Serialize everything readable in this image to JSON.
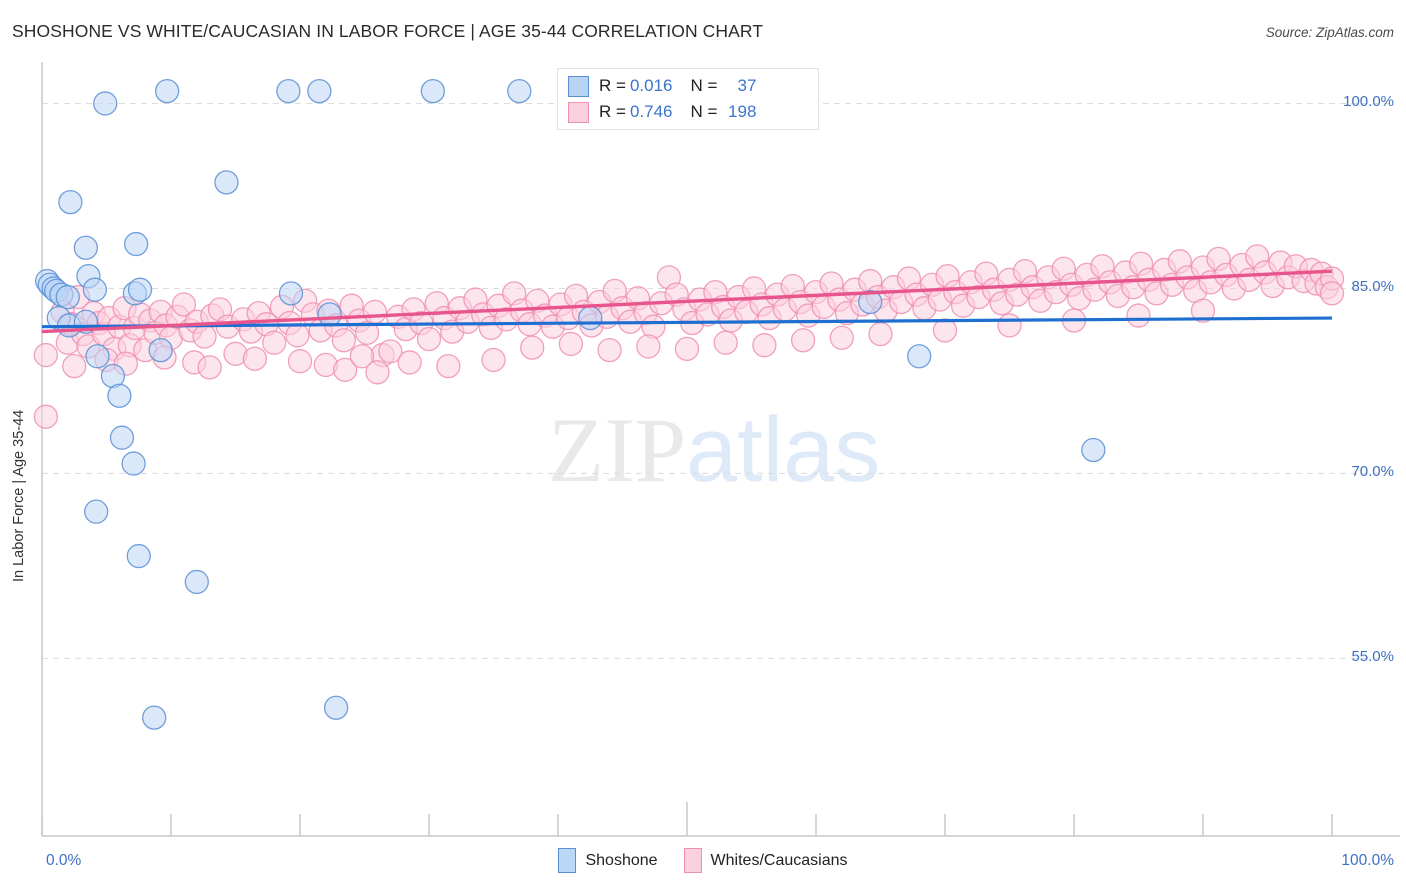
{
  "header": {
    "title": "SHOSHONE VS WHITE/CAUCASIAN IN LABOR FORCE | AGE 35-44 CORRELATION CHART",
    "source": "Source: ZipAtlas.com"
  },
  "watermark": {
    "part1": "ZIP",
    "part2": "atlas"
  },
  "axes": {
    "ylabel": "In Labor Force | Age 35-44",
    "yticks": [
      "100.0%",
      "85.0%",
      "70.0%",
      "55.0%"
    ],
    "xticks": [
      "0.0%",
      "100.0%"
    ]
  },
  "stats_legend": {
    "rows": [
      {
        "series": "Shoshone",
        "r_label": "R =",
        "r_value": "0.016",
        "n_label": "N =",
        "n_value": "37",
        "color": "#b9d3f2"
      },
      {
        "series": "Whites/Caucasians",
        "r_label": "R =",
        "r_value": "0.746",
        "n_label": "N =",
        "n_value": "198",
        "color": "#fbd0de"
      }
    ]
  },
  "series_legend": [
    {
      "label": "Shoshone",
      "color": "#bcd6f5"
    },
    {
      "label": "Whites/Caucasians",
      "color": "#fbd0de"
    }
  ],
  "colors": {
    "blue_fill": "#bcd6f5",
    "blue_stroke": "#5a8fd4",
    "pink_fill": "#fbd0de",
    "pink_stroke": "#ef8fb2",
    "blue_line": "#1f6fd0",
    "pink_line": "#e8548c",
    "tick_text": "#3f6fc4",
    "grid": "#dcdcdc"
  },
  "chart_data": {
    "type": "scatter",
    "title": "SHOSHONE VS WHITE/CAUCASIAN IN LABOR FORCE | AGE 35-44 CORRELATION CHART",
    "xlabel": "",
    "ylabel": "In Labor Force | Age 35-44",
    "xlim": [
      0,
      100
    ],
    "ylim": [
      40.6,
      103.2
    ],
    "xticks": [
      0,
      100
    ],
    "yticks": [
      100.0,
      85.0,
      70.0,
      55.0
    ],
    "grid": true,
    "legend_position": "bottom-center",
    "series": [
      {
        "name": "Shoshone",
        "color": "#bcd6f5",
        "R": 0.016,
        "N": 37,
        "trendline": {
          "x0": 0,
          "y0": 81.9,
          "x1": 100,
          "y1": 82.6
        },
        "points": [
          [
            4.9,
            100.0
          ],
          [
            9.7,
            101.0
          ],
          [
            19.1,
            101.0
          ],
          [
            21.5,
            101.0
          ],
          [
            30.3,
            101.0
          ],
          [
            37.0,
            101.0
          ],
          [
            14.3,
            93.6
          ],
          [
            2.2,
            92.0
          ],
          [
            3.4,
            88.3
          ],
          [
            7.3,
            88.6
          ],
          [
            0.4,
            85.6
          ],
          [
            0.6,
            85.3
          ],
          [
            0.9,
            85.0
          ],
          [
            1.1,
            84.8
          ],
          [
            1.5,
            84.5
          ],
          [
            2.0,
            84.3
          ],
          [
            3.6,
            86.0
          ],
          [
            4.1,
            84.9
          ],
          [
            7.2,
            84.6
          ],
          [
            7.6,
            84.9
          ],
          [
            19.3,
            84.6
          ],
          [
            1.3,
            82.6
          ],
          [
            2.1,
            82.0
          ],
          [
            3.4,
            82.3
          ],
          [
            22.3,
            82.9
          ],
          [
            42.5,
            82.6
          ],
          [
            64.2,
            83.9
          ],
          [
            4.3,
            79.5
          ],
          [
            9.2,
            80.0
          ],
          [
            68.0,
            79.5
          ],
          [
            5.5,
            77.9
          ],
          [
            6.0,
            76.3
          ],
          [
            6.2,
            72.9
          ],
          [
            7.1,
            70.8
          ],
          [
            4.2,
            66.9
          ],
          [
            7.5,
            63.3
          ],
          [
            12.0,
            61.2
          ],
          [
            81.5,
            71.9
          ],
          [
            8.7,
            50.2
          ],
          [
            22.8,
            51.0
          ]
        ]
      },
      {
        "name": "Whites/Caucasians",
        "color": "#fbd0de",
        "R": 0.746,
        "N": 198,
        "trendline": {
          "x0": 0,
          "y0": 81.5,
          "x1": 100,
          "y1": 86.4
        },
        "points": [
          [
            0.3,
            79.6
          ],
          [
            0.3,
            74.6
          ],
          [
            1.6,
            83.1
          ],
          [
            2.0,
            80.6
          ],
          [
            2.3,
            82.1
          ],
          [
            2.8,
            84.3
          ],
          [
            3.2,
            81.3
          ],
          [
            3.6,
            80.3
          ],
          [
            4.0,
            83.0
          ],
          [
            4.4,
            82.2
          ],
          [
            4.8,
            81.3
          ],
          [
            5.2,
            82.6
          ],
          [
            5.6,
            80.1
          ],
          [
            6.0,
            81.9
          ],
          [
            6.4,
            83.4
          ],
          [
            6.8,
            80.4
          ],
          [
            7.2,
            81.8
          ],
          [
            7.6,
            82.9
          ],
          [
            8.0,
            80.0
          ],
          [
            8.4,
            82.4
          ],
          [
            8.8,
            81.4
          ],
          [
            9.2,
            83.1
          ],
          [
            9.6,
            82.0
          ],
          [
            10.0,
            81.0
          ],
          [
            10.5,
            82.7
          ],
          [
            11.0,
            83.7
          ],
          [
            11.5,
            81.6
          ],
          [
            12.0,
            82.3
          ],
          [
            12.6,
            81.1
          ],
          [
            13.2,
            82.8
          ],
          [
            13.8,
            83.3
          ],
          [
            14.4,
            81.9
          ],
          [
            15.0,
            79.7
          ],
          [
            15.6,
            82.5
          ],
          [
            16.2,
            81.5
          ],
          [
            16.8,
            83.0
          ],
          [
            17.4,
            82.1
          ],
          [
            18.0,
            80.6
          ],
          [
            18.6,
            83.5
          ],
          [
            19.2,
            82.2
          ],
          [
            19.8,
            81.2
          ],
          [
            20.4,
            84.0
          ],
          [
            21.0,
            82.9
          ],
          [
            21.6,
            81.6
          ],
          [
            22.2,
            83.2
          ],
          [
            22.8,
            82.0
          ],
          [
            23.4,
            80.8
          ],
          [
            24.0,
            83.6
          ],
          [
            24.6,
            82.4
          ],
          [
            25.2,
            81.4
          ],
          [
            25.8,
            83.1
          ],
          [
            26.4,
            79.6
          ],
          [
            27.0,
            79.9
          ],
          [
            27.6,
            82.7
          ],
          [
            28.2,
            81.7
          ],
          [
            28.8,
            83.3
          ],
          [
            29.4,
            82.2
          ],
          [
            30.0,
            80.9
          ],
          [
            30.6,
            83.8
          ],
          [
            31.2,
            82.6
          ],
          [
            31.8,
            81.5
          ],
          [
            32.4,
            83.4
          ],
          [
            33.0,
            82.3
          ],
          [
            33.6,
            84.1
          ],
          [
            34.2,
            82.9
          ],
          [
            34.8,
            81.8
          ],
          [
            35.4,
            83.6
          ],
          [
            36.0,
            82.5
          ],
          [
            36.6,
            84.6
          ],
          [
            37.2,
            83.2
          ],
          [
            37.8,
            82.1
          ],
          [
            38.4,
            84.0
          ],
          [
            39.0,
            82.8
          ],
          [
            39.6,
            81.9
          ],
          [
            40.2,
            83.7
          ],
          [
            40.8,
            82.6
          ],
          [
            41.4,
            84.4
          ],
          [
            42.0,
            83.1
          ],
          [
            42.6,
            82.0
          ],
          [
            43.2,
            83.9
          ],
          [
            43.8,
            82.7
          ],
          [
            44.4,
            84.8
          ],
          [
            45.0,
            83.4
          ],
          [
            45.6,
            82.3
          ],
          [
            46.2,
            84.2
          ],
          [
            46.8,
            83.0
          ],
          [
            47.4,
            81.9
          ],
          [
            48.0,
            83.8
          ],
          [
            48.6,
            85.9
          ],
          [
            49.2,
            84.5
          ],
          [
            49.8,
            83.3
          ],
          [
            50.4,
            82.2
          ],
          [
            51.0,
            84.1
          ],
          [
            51.6,
            82.9
          ],
          [
            52.2,
            84.7
          ],
          [
            52.8,
            83.5
          ],
          [
            53.4,
            82.4
          ],
          [
            54.0,
            84.3
          ],
          [
            54.6,
            83.1
          ],
          [
            55.2,
            85.0
          ],
          [
            55.8,
            83.7
          ],
          [
            56.4,
            82.6
          ],
          [
            57.0,
            84.5
          ],
          [
            57.6,
            83.3
          ],
          [
            58.2,
            85.2
          ],
          [
            58.8,
            83.9
          ],
          [
            59.4,
            82.8
          ],
          [
            60.0,
            84.7
          ],
          [
            60.6,
            83.5
          ],
          [
            61.2,
            85.4
          ],
          [
            61.8,
            84.1
          ],
          [
            62.4,
            83.0
          ],
          [
            63.0,
            84.9
          ],
          [
            63.6,
            83.7
          ],
          [
            64.2,
            85.6
          ],
          [
            64.8,
            84.3
          ],
          [
            65.4,
            83.2
          ],
          [
            66.0,
            85.1
          ],
          [
            66.6,
            83.9
          ],
          [
            67.2,
            85.8
          ],
          [
            67.8,
            84.5
          ],
          [
            68.4,
            83.4
          ],
          [
            69.0,
            85.3
          ],
          [
            69.6,
            84.1
          ],
          [
            70.2,
            86.0
          ],
          [
            70.8,
            84.7
          ],
          [
            71.4,
            83.6
          ],
          [
            72.0,
            85.5
          ],
          [
            72.6,
            84.3
          ],
          [
            73.2,
            86.2
          ],
          [
            73.8,
            84.9
          ],
          [
            74.4,
            83.8
          ],
          [
            75.0,
            85.7
          ],
          [
            75.6,
            84.5
          ],
          [
            76.2,
            86.4
          ],
          [
            76.8,
            85.1
          ],
          [
            77.4,
            84.0
          ],
          [
            78.0,
            85.9
          ],
          [
            78.6,
            84.7
          ],
          [
            79.2,
            86.6
          ],
          [
            79.8,
            85.3
          ],
          [
            80.4,
            84.2
          ],
          [
            81.0,
            86.1
          ],
          [
            81.6,
            84.9
          ],
          [
            82.2,
            86.8
          ],
          [
            82.8,
            85.5
          ],
          [
            83.4,
            84.4
          ],
          [
            84.0,
            86.3
          ],
          [
            84.6,
            85.1
          ],
          [
            85.2,
            87.0
          ],
          [
            85.8,
            85.7
          ],
          [
            86.4,
            84.6
          ],
          [
            87.0,
            86.5
          ],
          [
            87.6,
            85.3
          ],
          [
            88.2,
            87.2
          ],
          [
            88.8,
            85.9
          ],
          [
            89.4,
            84.8
          ],
          [
            90.0,
            86.7
          ],
          [
            90.6,
            85.5
          ],
          [
            91.2,
            87.4
          ],
          [
            91.8,
            86.1
          ],
          [
            92.4,
            85.0
          ],
          [
            93.0,
            86.9
          ],
          [
            93.6,
            85.7
          ],
          [
            94.2,
            87.6
          ],
          [
            94.8,
            86.3
          ],
          [
            95.4,
            85.2
          ],
          [
            96.0,
            87.1
          ],
          [
            96.6,
            85.9
          ],
          [
            97.2,
            86.8
          ],
          [
            97.8,
            85.6
          ],
          [
            98.4,
            86.5
          ],
          [
            98.8,
            85.4
          ],
          [
            99.2,
            86.2
          ],
          [
            99.6,
            85.1
          ],
          [
            100.0,
            85.8
          ],
          [
            100.0,
            84.6
          ],
          [
            2.5,
            78.7
          ],
          [
            5.0,
            79.2
          ],
          [
            6.5,
            78.9
          ],
          [
            9.5,
            79.4
          ],
          [
            11.8,
            79.0
          ],
          [
            13.0,
            78.6
          ],
          [
            16.5,
            79.3
          ],
          [
            20.0,
            79.1
          ],
          [
            22.0,
            78.8
          ],
          [
            23.5,
            78.4
          ],
          [
            24.8,
            79.5
          ],
          [
            26.0,
            78.2
          ],
          [
            28.5,
            79.0
          ],
          [
            31.5,
            78.7
          ],
          [
            35.0,
            79.2
          ],
          [
            38.0,
            80.2
          ],
          [
            41.0,
            80.5
          ],
          [
            44.0,
            80.0
          ],
          [
            47.0,
            80.3
          ],
          [
            50.0,
            80.1
          ],
          [
            53.0,
            80.6
          ],
          [
            56.0,
            80.4
          ],
          [
            59.0,
            80.8
          ],
          [
            62.0,
            81.0
          ],
          [
            65.0,
            81.3
          ],
          [
            70.0,
            81.6
          ],
          [
            75.0,
            82.0
          ],
          [
            80.0,
            82.4
          ],
          [
            85.0,
            82.8
          ],
          [
            90.0,
            83.2
          ]
        ]
      }
    ]
  }
}
